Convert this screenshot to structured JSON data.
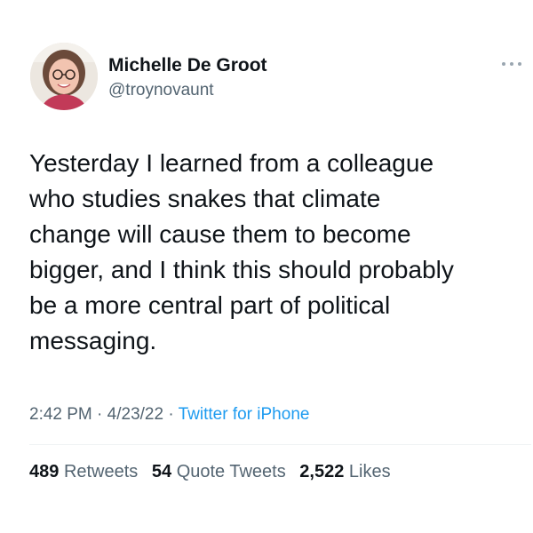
{
  "tweet": {
    "author": {
      "display_name": "Michelle De Groot",
      "handle": "@troynovaunt",
      "avatar": "profile-photo"
    },
    "more_icon": "more-horizontal-icon",
    "text_lines": [
      "Yesterday I learned from a colleague",
      "who studies snakes that climate",
      "change will cause them to become",
      "bigger, and I think this should probably",
      "be a more central part of political",
      "messaging."
    ],
    "meta": {
      "time": "2:42 PM",
      "date": "4/23/22",
      "separator": " · ",
      "source": "Twitter for iPhone"
    },
    "stats": {
      "retweets_count": "489",
      "retweets_label": "Retweets",
      "quote_tweets_count": "54",
      "quote_tweets_label": "Quote Tweets",
      "likes_count": "2,522",
      "likes_label": "Likes"
    }
  },
  "colors": {
    "text_primary": "#0f1419",
    "text_secondary": "#536471",
    "link": "#1d9bf0",
    "divider": "#eff3f4"
  }
}
